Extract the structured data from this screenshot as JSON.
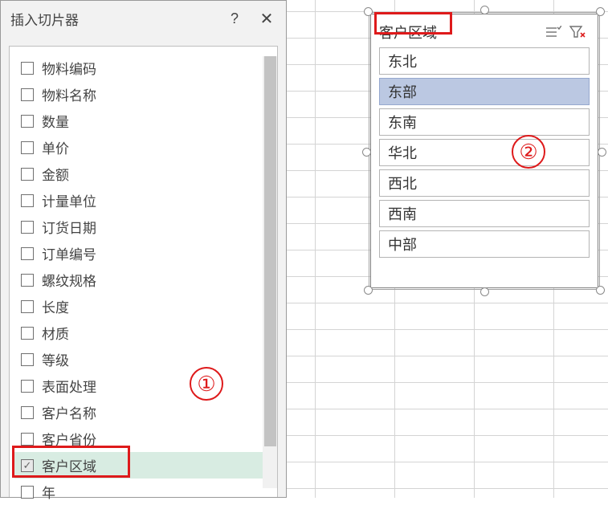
{
  "dialog": {
    "title": "插入切片器",
    "help_label": "?",
    "close_label": "✕",
    "fields": [
      {
        "label": "物料编码",
        "checked": false
      },
      {
        "label": "物料名称",
        "checked": false
      },
      {
        "label": "数量",
        "checked": false
      },
      {
        "label": "单价",
        "checked": false
      },
      {
        "label": "金额",
        "checked": false
      },
      {
        "label": "计量单位",
        "checked": false
      },
      {
        "label": "订货日期",
        "checked": false
      },
      {
        "label": "订单编号",
        "checked": false
      },
      {
        "label": "螺纹规格",
        "checked": false
      },
      {
        "label": "长度",
        "checked": false
      },
      {
        "label": "材质",
        "checked": false
      },
      {
        "label": "等级",
        "checked": false
      },
      {
        "label": "表面处理",
        "checked": false
      },
      {
        "label": "客户名称",
        "checked": false
      },
      {
        "label": "客户省份",
        "checked": false
      },
      {
        "label": "客户区域",
        "checked": true
      },
      {
        "label": "年",
        "checked": false
      }
    ]
  },
  "slicer": {
    "title": "客户区域",
    "items": [
      {
        "label": "东北",
        "selected": false
      },
      {
        "label": "东部",
        "selected": true
      },
      {
        "label": "东南",
        "selected": false
      },
      {
        "label": "华北",
        "selected": false
      },
      {
        "label": "西北",
        "selected": false
      },
      {
        "label": "西南",
        "selected": false
      },
      {
        "label": "中部",
        "selected": false
      }
    ]
  },
  "annotations": {
    "one": "①",
    "two": "②"
  }
}
